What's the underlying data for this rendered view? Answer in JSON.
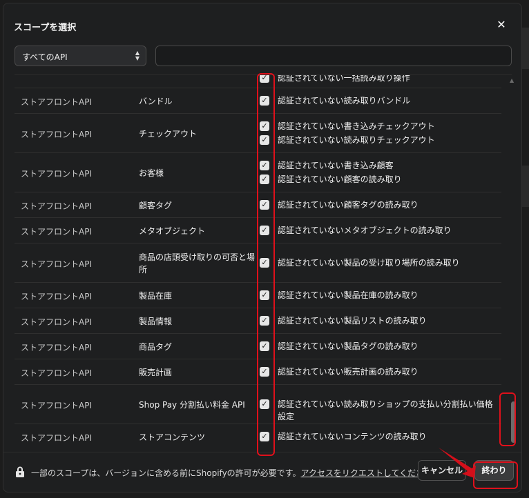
{
  "backdrop": {
    "top_text": "スコープを選択",
    "bottom_text": "ストアフロント API"
  },
  "modal": {
    "title": "スコープを選択",
    "close_icon": "close-icon"
  },
  "filter": {
    "select_value": "すべてのAPI",
    "search_value": "",
    "search_placeholder": ""
  },
  "rows": [
    {
      "api": "",
      "name": "",
      "scopes": [
        "認証されていない一括読み取り操作"
      ]
    },
    {
      "api": "ストアフロントAPI",
      "name": "バンドル",
      "scopes": [
        "認証されていない読み取りバンドル"
      ]
    },
    {
      "api": "ストアフロントAPI",
      "name": "チェックアウト",
      "scopes": [
        "認証されていない書き込みチェックアウト",
        "認証されていない読み取りチェックアウト"
      ]
    },
    {
      "api": "ストアフロントAPI",
      "name": "お客様",
      "scopes": [
        "認証されていない書き込み顧客",
        "認証されていない顧客の読み取り"
      ]
    },
    {
      "api": "ストアフロントAPI",
      "name": "顧客タグ",
      "scopes": [
        "認証されていない顧客タグの読み取り"
      ]
    },
    {
      "api": "ストアフロントAPI",
      "name": "メタオブジェクト",
      "scopes": [
        "認証されていないメタオブジェクトの読み取り"
      ]
    },
    {
      "api": "ストアフロントAPI",
      "name": "商品の店頭受け取りの可否と場所",
      "scopes": [
        "認証されていない製品の受け取り場所の読み取り"
      ]
    },
    {
      "api": "ストアフロントAPI",
      "name": "製品在庫",
      "scopes": [
        "認証されていない製品在庫の読み取り"
      ]
    },
    {
      "api": "ストアフロントAPI",
      "name": "製品情報",
      "scopes": [
        "認証されていない製品リストの読み取り"
      ]
    },
    {
      "api": "ストアフロントAPI",
      "name": "商品タグ",
      "scopes": [
        "認証されていない製品タグの読み取り"
      ]
    },
    {
      "api": "ストアフロントAPI",
      "name": "販売計画",
      "scopes": [
        "認証されていない販売計画の読み取り"
      ]
    },
    {
      "api": "ストアフロントAPI",
      "name": "Shop Pay 分割払い料金 API",
      "scopes": [
        "認証されていない読み取りショップの支払い分割払い価格設定"
      ]
    },
    {
      "api": "ストアフロントAPI",
      "name": "ストアコンテンツ",
      "scopes": [
        "認証されていないコンテンツの読み取り"
      ]
    }
  ],
  "checkbox_state": "checked",
  "footer": {
    "lock_icon": "lock-icon",
    "notice": "一部のスコープは、バージョンに含める前にShopifyの許可が必要です。",
    "link": "アクセスをリクエストしてください。",
    "external_icon": "external-link-icon",
    "cancel_label": "キャンセル",
    "done_label": "終わり"
  },
  "colors": {
    "highlight": "#e0101b",
    "background": "#1e1f20"
  }
}
